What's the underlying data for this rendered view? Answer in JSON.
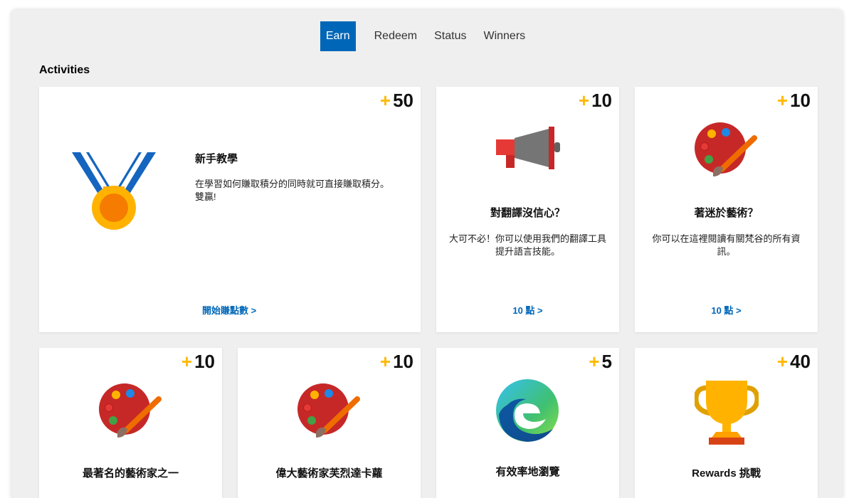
{
  "tabs": [
    {
      "label": "Earn",
      "active": true
    },
    {
      "label": "Redeem",
      "active": false
    },
    {
      "label": "Status",
      "active": false
    },
    {
      "label": "Winners",
      "active": false
    }
  ],
  "section_title": "Activities",
  "colors": {
    "accent": "#0067b8",
    "plus": "#ffb900",
    "background": "#efefef"
  },
  "cards": [
    {
      "icon": "medal-icon",
      "plus": "+",
      "points": "50",
      "title": "新手教學",
      "desc": "在學習如何賺取積分的同時就可直接賺取積分。雙贏!",
      "link": "開始賺點數 >"
    },
    {
      "icon": "megaphone-icon",
      "plus": "+",
      "points": "10",
      "title": "對翻譯沒信心？",
      "desc": "大可不必！你可以使用我們的翻譯工具提升語言技能。",
      "link": "10 點 >"
    },
    {
      "icon": "palette-icon",
      "plus": "+",
      "points": "10",
      "title": "著迷於藝術？",
      "desc": "你可以在這裡閱讀有關梵谷的所有資訊。",
      "link": "10 點 >"
    },
    {
      "icon": "palette-icon",
      "plus": "+",
      "points": "10",
      "title": "最著名的藝術家之一"
    },
    {
      "icon": "palette-icon",
      "plus": "+",
      "points": "10",
      "title": "偉大藝術家芙烈達卡蘿"
    },
    {
      "icon": "edge-browser-icon",
      "plus": "+",
      "points": "5",
      "title": "有效率地瀏覽"
    },
    {
      "icon": "trophy-icon",
      "plus": "+",
      "points": "40",
      "title": "Rewards 挑戰"
    }
  ]
}
